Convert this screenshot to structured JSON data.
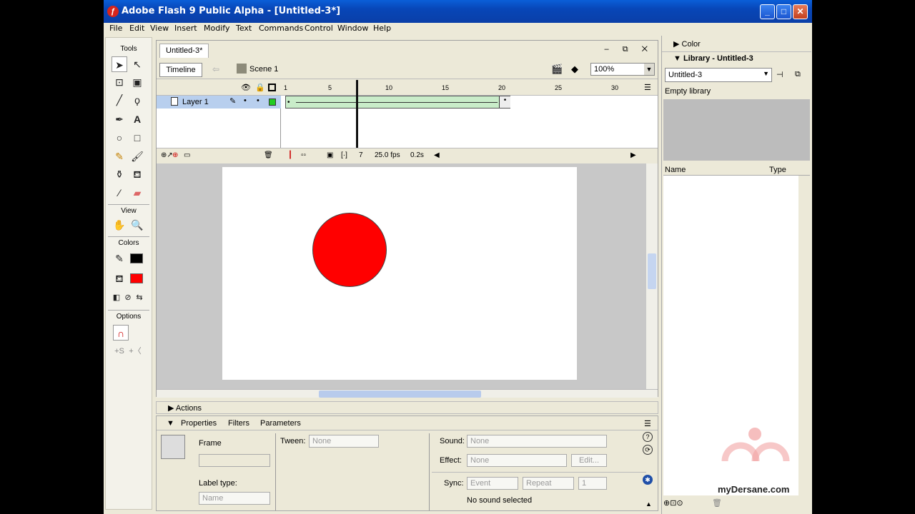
{
  "window": {
    "title": "Adobe Flash 9 Public Alpha - [Untitled-3*]"
  },
  "menu": [
    "File",
    "Edit",
    "View",
    "Insert",
    "Modify",
    "Text",
    "Commands",
    "Control",
    "Window",
    "Help"
  ],
  "tools": {
    "header": "Tools",
    "view_header": "View",
    "colors_header": "Colors",
    "options_header": "Options",
    "stroke_color": "#000000",
    "fill_color": "#ff0000"
  },
  "document": {
    "tab": "Untitled-3*",
    "timeline_button": "Timeline",
    "scene": "Scene 1",
    "zoom": "100%"
  },
  "timeline": {
    "ticks": [
      "1",
      "5",
      "10",
      "15",
      "20",
      "25",
      "30"
    ],
    "layer_name": "Layer 1",
    "current_frame": "7",
    "fps": "25.0 fps",
    "time": "0.2s",
    "layer_color": "#22cc22"
  },
  "stage": {
    "circle_color": "#ff0000"
  },
  "actions": {
    "label": "Actions"
  },
  "properties": {
    "tabs": [
      "Properties",
      "Filters",
      "Parameters"
    ],
    "frame_label": "Frame",
    "label_type_label": "Label type:",
    "label_type_value": "Name",
    "tween_label": "Tween:",
    "tween_value": "None",
    "sound_label": "Sound:",
    "sound_value": "None",
    "effect_label": "Effect:",
    "effect_value": "None",
    "edit_button": "Edit...",
    "sync_label": "Sync:",
    "sync_value": "Event",
    "repeat_value": "Repeat",
    "repeat_count": "1",
    "no_sound": "No sound selected"
  },
  "right_panel": {
    "color_header": "Color",
    "library_header": "Library - Untitled-3",
    "library_select": "Untitled-3",
    "empty_library": "Empty library",
    "col_name": "Name",
    "col_type": "Type"
  },
  "watermark": {
    "text": "myDersane.com"
  }
}
